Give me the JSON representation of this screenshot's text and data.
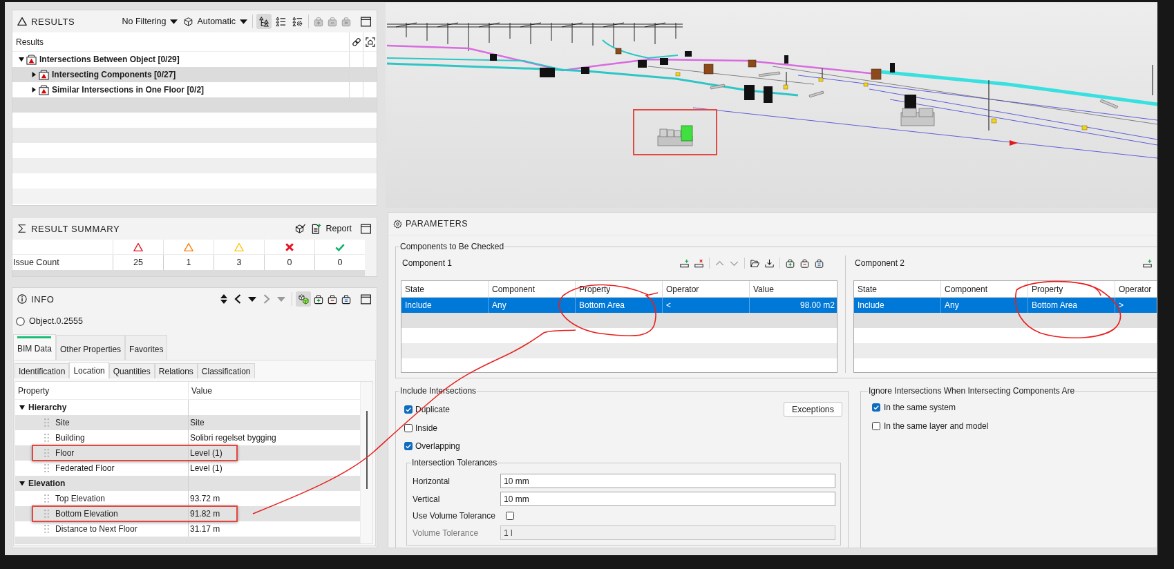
{
  "results": {
    "title": "RESULTS",
    "filter": "No Filtering",
    "mode": "Automatic",
    "view_modes": [
      {
        "kind": "tree",
        "selected": true
      },
      {
        "kind": "list",
        "selected": false
      },
      {
        "kind": "list-settings",
        "selected": false
      }
    ],
    "bag_tools": [
      {
        "kind": "add",
        "disabled": true
      },
      {
        "kind": "remove",
        "disabled": true
      },
      {
        "kind": "list",
        "disabled": true
      }
    ],
    "column": "Results",
    "tree": [
      {
        "label": "Intersections Between Object [0/29]",
        "expanded": true,
        "selected": false,
        "children": [
          {
            "label": "Intersecting Components [0/27]",
            "expanded": false,
            "selected": true
          },
          {
            "label": "Similar Intersections in One Floor [0/2]",
            "expanded": false,
            "selected": false
          }
        ]
      }
    ]
  },
  "result_summary": {
    "title": "RESULT SUMMARY",
    "report_button": "Report",
    "columns": [
      {
        "kind": "triangle",
        "color": "#e3121b"
      },
      {
        "kind": "triangle",
        "color": "#ff7b00"
      },
      {
        "kind": "triangle",
        "color": "#ffc400"
      },
      {
        "kind": "cross",
        "color": "#e81123"
      },
      {
        "kind": "check",
        "color": "#10b26c"
      }
    ],
    "rows": [
      {
        "label": "Issue Count",
        "values": [
          "25",
          "1",
          "3",
          "0",
          "0"
        ]
      }
    ]
  },
  "info": {
    "title": "INFO",
    "nav": [
      {
        "kind": "up-down",
        "disabled": false
      },
      {
        "kind": "previous",
        "disabled": false
      },
      {
        "kind": "menu",
        "disabled": false
      },
      {
        "kind": "next",
        "disabled": true
      },
      {
        "kind": "menu",
        "disabled": true
      }
    ],
    "view_toggle": {
      "selected": true
    },
    "bag_tools": [
      {
        "kind": "add",
        "disabled": false
      },
      {
        "kind": "remove",
        "disabled": false
      },
      {
        "kind": "list",
        "disabled": false
      }
    ],
    "object": "Object.0.2555",
    "tabs": [
      {
        "label": "BIM Data",
        "selected": true
      },
      {
        "label": "Other Properties",
        "selected": false
      },
      {
        "label": "Favorites",
        "selected": false
      }
    ],
    "subtabs": [
      {
        "label": "Identification",
        "selected": false
      },
      {
        "label": "Location",
        "selected": true
      },
      {
        "label": "Quantities",
        "selected": false
      },
      {
        "label": "Relations",
        "selected": false
      },
      {
        "label": "Classification",
        "selected": false
      }
    ],
    "columns": [
      "Property",
      "Value"
    ],
    "groups": [
      {
        "label": "Hierarchy",
        "expanded": true,
        "children": [
          {
            "property": "Site",
            "value": "Site",
            "marked": false
          },
          {
            "property": "Building",
            "value": "Solibri regelset bygging",
            "marked": false
          },
          {
            "property": "Floor",
            "value": "Level (1)",
            "marked": true
          },
          {
            "property": "Federated Floor",
            "value": "Level (1)",
            "marked": false
          }
        ]
      },
      {
        "label": "Elevation",
        "expanded": true,
        "children": [
          {
            "property": "Top Elevation",
            "value": "93.72 m",
            "marked": false
          },
          {
            "property": "Bottom Elevation",
            "value": "91.82 m",
            "marked": true
          },
          {
            "property": "Distance to Next Floor",
            "value": "31.17 m",
            "marked": false
          }
        ]
      }
    ]
  },
  "parameters": {
    "title": "PARAMETERS",
    "components_title": "Components to Be Checked",
    "components": [
      {
        "title": "Component 1",
        "toolbar": [
          {
            "kind": "add-row",
            "disabled": false
          },
          {
            "kind": "remove-row",
            "disabled": false
          },
          {
            "kind": "move-up",
            "disabled": true
          },
          {
            "kind": "move-down",
            "disabled": true
          },
          {
            "kind": "open",
            "disabled": false
          },
          {
            "kind": "import",
            "disabled": false
          },
          {
            "kind": "bag-add",
            "disabled": false
          },
          {
            "kind": "bag-remove",
            "disabled": false
          },
          {
            "kind": "bag-list",
            "disabled": false
          }
        ],
        "columns": [
          "State",
          "Component",
          "Property",
          "Operator",
          "Value"
        ],
        "rows": [
          {
            "cells": [
              "Include",
              "Any",
              "Bottom Area",
              "<",
              "98.00 m2"
            ],
            "selected": true
          }
        ]
      },
      {
        "title": "Component 2",
        "toolbar": [
          {
            "kind": "add-row",
            "disabled": false
          }
        ],
        "columns": [
          "State",
          "Component",
          "Property",
          "Operator"
        ],
        "rows": [
          {
            "cells": [
              "Include",
              "Any",
              "Bottom Area",
              ">"
            ],
            "selected": true
          }
        ]
      }
    ],
    "include": {
      "title": "Include Intersections",
      "options": [
        {
          "label": "Duplicate",
          "checked": true
        },
        {
          "label": "Inside",
          "checked": false
        },
        {
          "label": "Overlapping",
          "checked": true
        }
      ],
      "exceptions_button": "Exceptions",
      "tolerances": {
        "title": "Intersection Tolerances",
        "fields": [
          {
            "kind": "text",
            "label": "Horizontal",
            "value": "10 mm",
            "disabled": false
          },
          {
            "kind": "text",
            "label": "Vertical",
            "value": "10 mm",
            "disabled": false
          },
          {
            "kind": "checkbox",
            "label": "Use Volume Tolerance",
            "checked": false
          },
          {
            "kind": "text",
            "label": "Volume Tolerance",
            "value": "1 l",
            "disabled": true
          }
        ]
      }
    },
    "ignore": {
      "title": "Ignore Intersections When Intersecting Components Are",
      "options": [
        {
          "label": "In the same system",
          "checked": true
        },
        {
          "label": "In the same layer and model",
          "checked": false
        }
      ]
    }
  }
}
